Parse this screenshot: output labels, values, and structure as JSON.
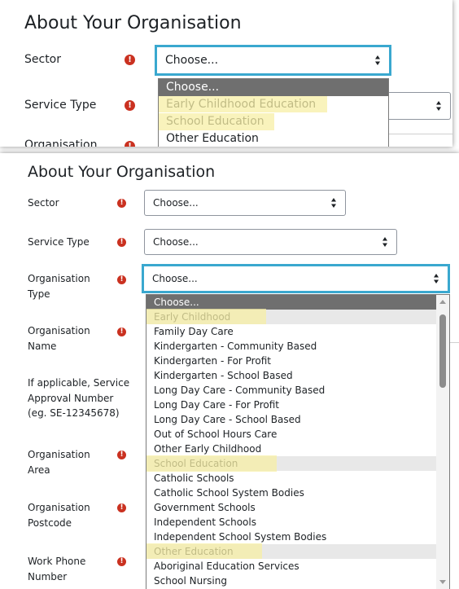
{
  "panel1": {
    "title": "About Your Organisation",
    "sector_label": "Sector",
    "service_type_label": "Service Type",
    "organisation_label_cut": "Organisation",
    "sector_value": "Choose...",
    "dropdown_options": [
      "Choose...",
      "Early Childhood Education",
      "School Education",
      "Other Education"
    ]
  },
  "panel2": {
    "title": "About Your Organisation",
    "labels": {
      "sector": "Sector",
      "service_type": "Service Type",
      "organisation_type_1": "Organisation",
      "organisation_type_2": "Type",
      "organisation_name_1": "Organisation",
      "organisation_name_2": "Name",
      "approval_1": "If applicable, Service",
      "approval_2": "Approval Number",
      "approval_3": "(eg. SE-12345678)",
      "organisation_area_1": "Organisation",
      "organisation_area_2": "Area",
      "organisation_postcode_1": "Organisation",
      "organisation_postcode_2": "Postcode",
      "work_phone_1": "Work Phone",
      "work_phone_2": "Number"
    },
    "sector_value": "Choose...",
    "service_type_value": "Choose...",
    "organisation_type_value": "Choose...",
    "dropdown_options": [
      "Choose...",
      "Early Childhood",
      "Family Day Care",
      "Kindergarten - Community Based",
      "Kindergarten - For Profit",
      "Kindergarten - School Based",
      "Long Day Care - Community Based",
      "Long Day Care - For Profit",
      "Long Day Care - School Based",
      "Out of School Hours Care",
      "Other Early Childhood",
      "School Education",
      "Catholic Schools",
      "Catholic School System Bodies",
      "Government Schools",
      "Independent Schools",
      "Independent School System Bodies",
      "Other Education",
      "Aboriginal Education Services",
      "School Nursing"
    ]
  },
  "colors": {
    "focus_border": "#3aa8cf",
    "required_icon": "#ca3120",
    "selected_option_bg": "#6f6f6f",
    "group_option_bg": "#e8e8e8",
    "highlight": "#f7efa6"
  }
}
